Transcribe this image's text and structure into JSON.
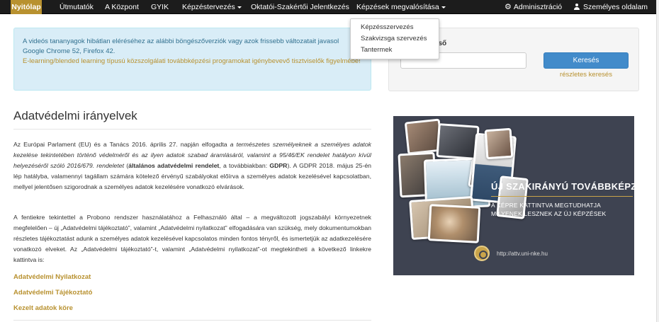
{
  "navbar": {
    "items": [
      {
        "label": "Nyitólap"
      },
      {
        "label": "Útmutatók"
      },
      {
        "label": "A Központ"
      },
      {
        "label": "GYIK"
      },
      {
        "label": "Képzéstervezés"
      },
      {
        "label": "Oktatói-Szakértői Jelentkezés"
      },
      {
        "label": "Képzések megvalósítása"
      }
    ],
    "admin_label": "Adminisztráció",
    "profile_label": "Személyes oldalam",
    "dropdown_items": [
      {
        "label": "Képzésszervezés"
      },
      {
        "label": "Szakvizsga szervezés"
      },
      {
        "label": "Tantermek"
      }
    ]
  },
  "info": {
    "line1": "A videós tananyagok hibátlan eléréséhez az alábbi böngészőverziók vagy azok frissebb változatait javasol",
    "line2": "Google Chrome 52, Firefox 42.",
    "link": "E-learning/blended learning típusú közszolgálati továbbképzési programokat igénybevevő tisztviselők figyelmébe!"
  },
  "search": {
    "label": "reső",
    "placeholder": "",
    "button": "Keresés",
    "advanced": "részletes keresés"
  },
  "main": {
    "title": "Adatvédelmi irányelvek",
    "p1": {
      "t1": "Az Európai Parlament (EU) és a Tanács 2016. április 27. napján elfogadta ",
      "t2": "a természetes személyeknek a személyes adatok kezelése tekintetében történő védelméről és az ilyen adatok szabad áramlásáról, valamint a 95/46/EK rendelet hatályon kívül helyezéséről szóló 2016/679. rendeletet",
      "t3": " (",
      "t4": "általános adatvédelmi rendelet",
      "t5": ", a továbbiakban: ",
      "t6": "GDPR",
      "t7": "). A GDPR 2018. május 25-én lép hatályba, valamennyi tagállam számára kötelező érvényű szabályokat előírva a személyes adatok kezelésével kapcsolatban, mellyel jelentősen szigorodnak a személyes adatok kezelésére vonatkozó elvárások."
    },
    "p2": "A fentiekre tekintettel a Probono rendszer használatához a Felhasználó által – a megváltozott jogszabályi környezetnek megfelelően – új „Adatvédelmi tájékoztató”, valamint „Adatvédelmi nyilatkozat” elfogadására van szükség, mely dokumentumokban részletes tájékoztatást adunk a személyes adatok kezelésével kapcsolatos minden fontos tényről, és ismertetjük az adatkezelésére vonatkozó elveket. Az „Adatvédelmi tájékoztató”-t, valamint „Adatvédelmi nyilatkozat”-ot megtekintheti a következő linkekre kattintva is:",
    "links": [
      {
        "label": "Adatvédelmi Nyilatkozat"
      },
      {
        "label": "Adatvédelmi Tájékoztató"
      },
      {
        "label": "Kezelt adatok köre"
      }
    ]
  },
  "banner": {
    "heading": "ÚJ SZAKIRÁNYÚ TOVÁBBKÉPZÉS",
    "sub1": "A KÉPRE KATTINTVA MEGTUDHATJA",
    "sub2": "MILYENEK LESZNEK AZ ÚJ KÉPZÉSEK",
    "url": "http://attv.uni-nke.hu"
  },
  "colors": {
    "navbar_bg": "#1c1c1c",
    "accent_gold": "#b8912f",
    "info_bg": "#d9edf7",
    "info_text": "#31708f",
    "primary_button": "#428bca",
    "banner_bg": "#3e4351"
  },
  "icons": {
    "admin": "gear-icon",
    "profile": "user-icon",
    "dropdown": "caret-down-icon"
  }
}
